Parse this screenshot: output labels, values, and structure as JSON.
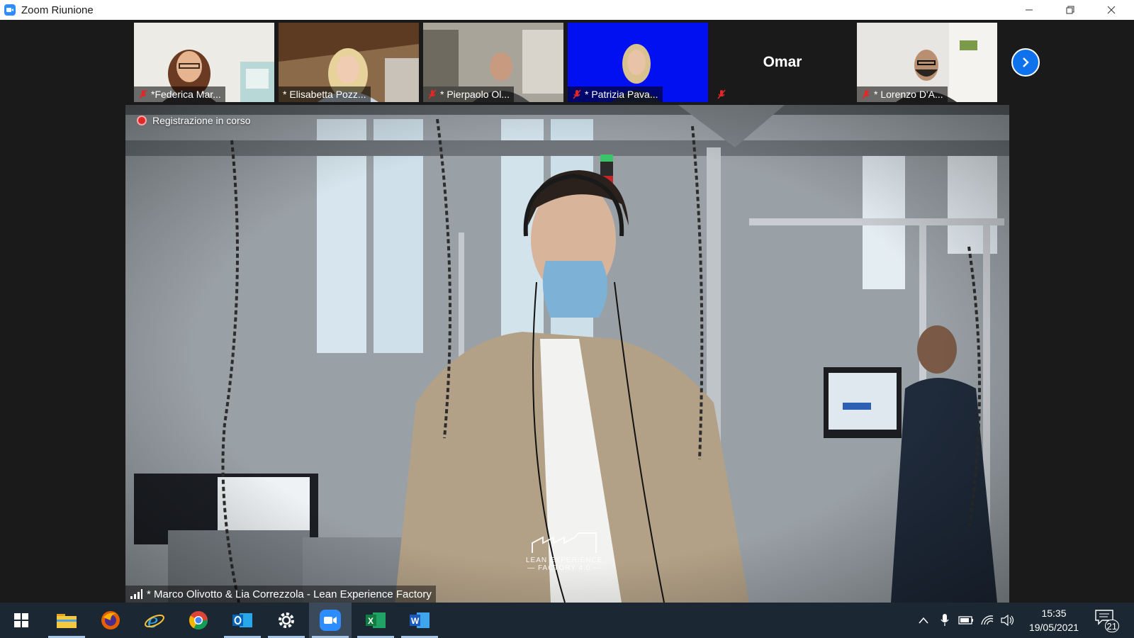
{
  "window": {
    "title": "Zoom Riunione",
    "icon": "zoom-icon",
    "controls": [
      "minimize-icon",
      "restore-icon",
      "close-icon"
    ]
  },
  "participants": [
    {
      "name": "*Federica Mar...",
      "muted": true
    },
    {
      "name": "* Elisabetta Pozz...",
      "muted": false
    },
    {
      "name": "* Pierpaolo Ol...",
      "muted": true
    },
    {
      "name": "* Patrizia Pava...",
      "muted": true
    },
    {
      "name": "Omar",
      "muted": true,
      "video": false
    },
    {
      "name": "* Lorenzo D'A...",
      "muted": true
    }
  ],
  "gallery": {
    "next_icon": "chevron-right-icon"
  },
  "main": {
    "recording_status": "Registrazione in corso",
    "speaker_label": "* Marco Olivotto & Lia Correzzola - Lean Experience Factory",
    "watermark_line1": "LEAN EXPERIENCE",
    "watermark_line2": "— FACTORY 4.0 —"
  },
  "taskbar": {
    "apps": [
      "windows-start-icon",
      "file-explorer-icon",
      "firefox-icon",
      "internet-explorer-icon",
      "chrome-icon",
      "outlook-icon",
      "settings-icon",
      "zoom-icon",
      "excel-icon",
      "word-icon"
    ],
    "active_app": "zoom-icon",
    "time": "15:35",
    "date": "19/05/2021",
    "notification_count": "21"
  },
  "colors": {
    "zoom_blue": "#2d8cff",
    "patrizia_bg": "#0000ff",
    "recording_red": "#e02828",
    "mute_red": "#e02828",
    "taskbar": "#1b2834"
  }
}
